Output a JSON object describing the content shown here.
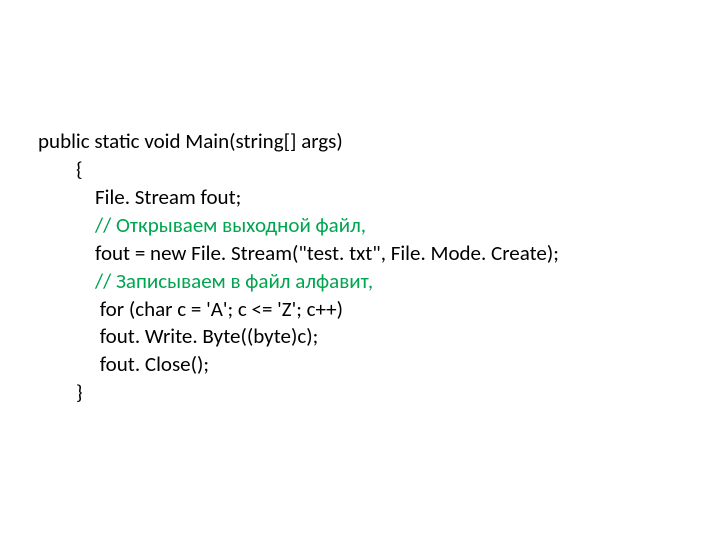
{
  "code": {
    "line1": "public static void Main(string[] args)",
    "line2": "        {",
    "line3": "            File. Stream fout;",
    "line4": "            // Открываем выходной файл,",
    "line5": "            fout = new File. Stream(\"test. txt\", File. Mode. Create);",
    "line6": "            // Записываем в файл алфавит,",
    "line7": "             for (char c = 'A'; c <= 'Z'; c++)",
    "line8": "             fout. Write. Byte((byte)c);",
    "line9": "             fout. Close();",
    "line10": "        }"
  }
}
